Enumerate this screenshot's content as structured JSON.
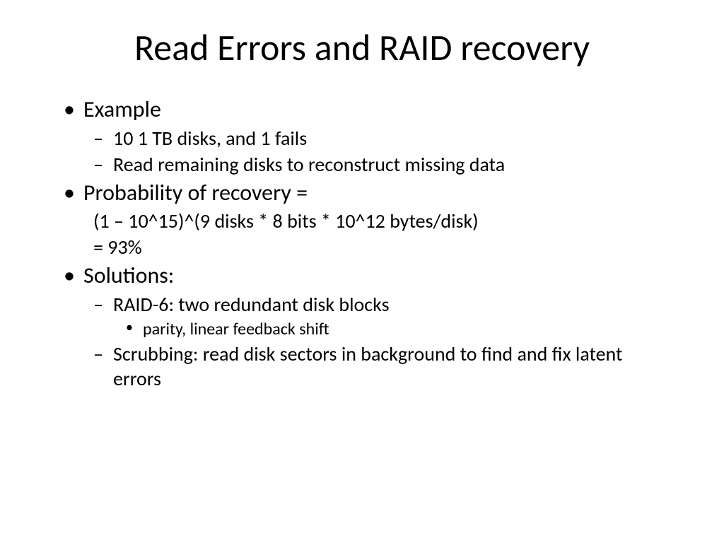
{
  "title": "Read Errors and RAID recovery",
  "bullets": {
    "b1": "Example",
    "b1a": "10 1 TB disks, and 1 fails",
    "b1b": "Read remaining disks to reconstruct missing data",
    "b2": "Probability of recovery =",
    "b2a": "(1 – 10^15)^(9 disks * 8 bits * 10^12 bytes/disk)",
    "b2b": "= 93%",
    "b3": "Solutions:",
    "b3a": "RAID-6: two redundant disk blocks",
    "b3a1": "parity, linear feedback shift",
    "b3b": "Scrubbing: read disk sectors in background to find and fix latent errors"
  }
}
